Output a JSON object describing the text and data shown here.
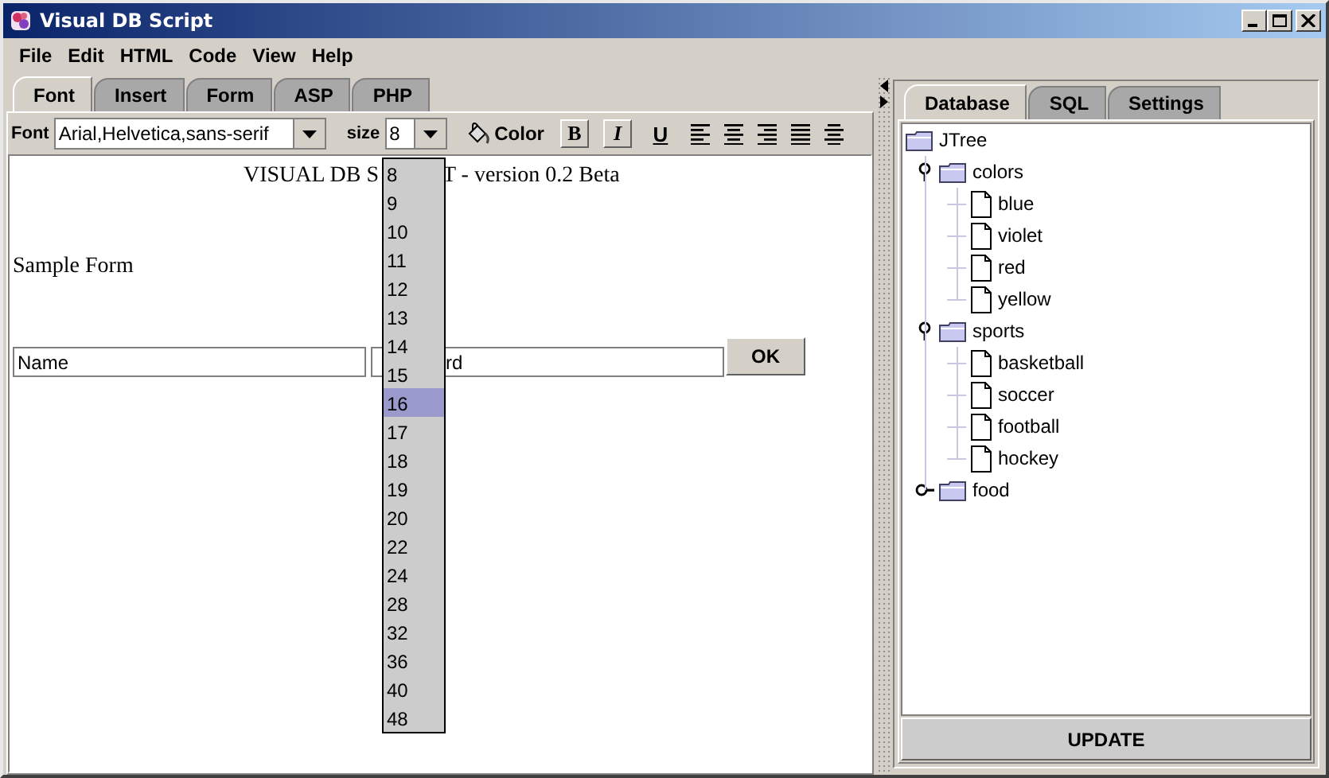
{
  "window": {
    "title": "Visual DB Script"
  },
  "menu": [
    "File",
    "Edit",
    "HTML",
    "Code",
    "View",
    "Help"
  ],
  "editor_tabs": [
    {
      "label": "Font",
      "selected": true
    },
    {
      "label": "Insert",
      "selected": false
    },
    {
      "label": "Form",
      "selected": false
    },
    {
      "label": "ASP",
      "selected": false
    },
    {
      "label": "PHP",
      "selected": false
    }
  ],
  "toolbar": {
    "font_label": "Font",
    "font_value": "Arial,Helvetica,sans-serif",
    "size_label": "size",
    "size_value": "8",
    "color_button": "Color",
    "format_buttons": [
      "B",
      "I",
      "U"
    ]
  },
  "size_dropdown": {
    "options": [
      {
        "label": "8",
        "selected": false
      },
      {
        "label": "9",
        "selected": false
      },
      {
        "label": "10",
        "selected": false
      },
      {
        "label": "11",
        "selected": false
      },
      {
        "label": "12",
        "selected": false
      },
      {
        "label": "13",
        "selected": false
      },
      {
        "label": "14",
        "selected": false
      },
      {
        "label": "15",
        "selected": false
      },
      {
        "label": "16",
        "selected": true
      },
      {
        "label": "17",
        "selected": false
      },
      {
        "label": "18",
        "selected": false
      },
      {
        "label": "19",
        "selected": false
      },
      {
        "label": "20",
        "selected": false
      },
      {
        "label": "22",
        "selected": false
      },
      {
        "label": "24",
        "selected": false
      },
      {
        "label": "28",
        "selected": false
      },
      {
        "label": "32",
        "selected": false
      },
      {
        "label": "36",
        "selected": false
      },
      {
        "label": "40",
        "selected": false
      },
      {
        "label": "48",
        "selected": false
      }
    ]
  },
  "document": {
    "heading_parts": [
      "VISUAL DB S",
      "T - version 0.2 Beta"
    ],
    "paragraph": "Sample Form",
    "fields": [
      {
        "value": "Name"
      },
      {
        "value": "rd"
      }
    ],
    "button": "OK"
  },
  "side_tabs": [
    {
      "label": "Database",
      "selected": true
    },
    {
      "label": "SQL",
      "selected": false
    },
    {
      "label": "Settings",
      "selected": false
    }
  ],
  "tree": {
    "label": "JTree",
    "kind": "folder",
    "children": [
      {
        "label": "colors",
        "kind": "folder",
        "expanded": true,
        "children": [
          {
            "label": "blue",
            "kind": "leaf"
          },
          {
            "label": "violet",
            "kind": "leaf"
          },
          {
            "label": "red",
            "kind": "leaf"
          },
          {
            "label": "yellow",
            "kind": "leaf"
          }
        ]
      },
      {
        "label": "sports",
        "kind": "folder",
        "expanded": true,
        "children": [
          {
            "label": "basketball",
            "kind": "leaf"
          },
          {
            "label": "soccer",
            "kind": "leaf"
          },
          {
            "label": "football",
            "kind": "leaf"
          },
          {
            "label": "hockey",
            "kind": "leaf"
          }
        ]
      },
      {
        "label": "food",
        "kind": "folder",
        "expanded": false
      }
    ]
  },
  "update_button": "UPDATE"
}
